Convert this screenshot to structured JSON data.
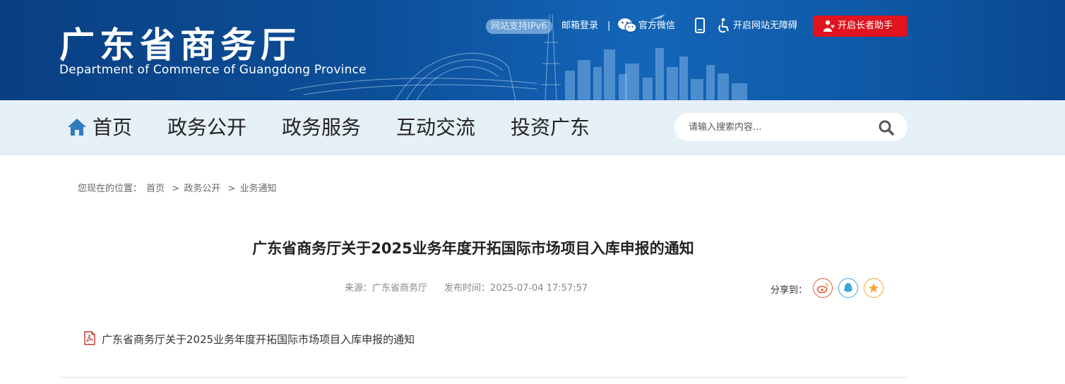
{
  "header": {
    "title": "广东省商务厅",
    "subtitle": "Department of Commerce of Guangdong Province",
    "ipv6_badge": "网站支持IPv6",
    "mail_login": "邮箱登录",
    "separator": "|",
    "wechat": "官方微信",
    "accessibility": "开启网站无障碍",
    "elder_mode": "开启长者助手",
    "colors": {
      "banner": "#0c4f99",
      "elder_button": "#e0141e"
    }
  },
  "nav": {
    "items": [
      {
        "label": "首页",
        "icon": "home-icon"
      },
      {
        "label": "政务公开"
      },
      {
        "label": "政务服务"
      },
      {
        "label": "互动交流"
      },
      {
        "label": "投资广东"
      }
    ],
    "search": {
      "placeholder": "请输入搜索内容...",
      "value": ""
    }
  },
  "breadcrumb": {
    "prefix": "您现在的位置：",
    "items": [
      "首页",
      "政务公开",
      "业务通知"
    ],
    "separator": ">"
  },
  "article": {
    "title": "广东省商务厅关于2025业务年度开拓国际市场项目入库申报的通知",
    "source_label": "来源：",
    "source": "广东省商务厅",
    "publish_label": "发布时间：",
    "publish_time": "2025-07-04 17:57:57",
    "share_label": "分享到：",
    "share_targets": [
      "weibo-icon",
      "qq-icon",
      "qzone-icon"
    ],
    "attachment": {
      "icon": "pdf-icon",
      "name": "广东省商务厅关于2025业务年度开拓国际市场项目入库申报的通知"
    }
  }
}
